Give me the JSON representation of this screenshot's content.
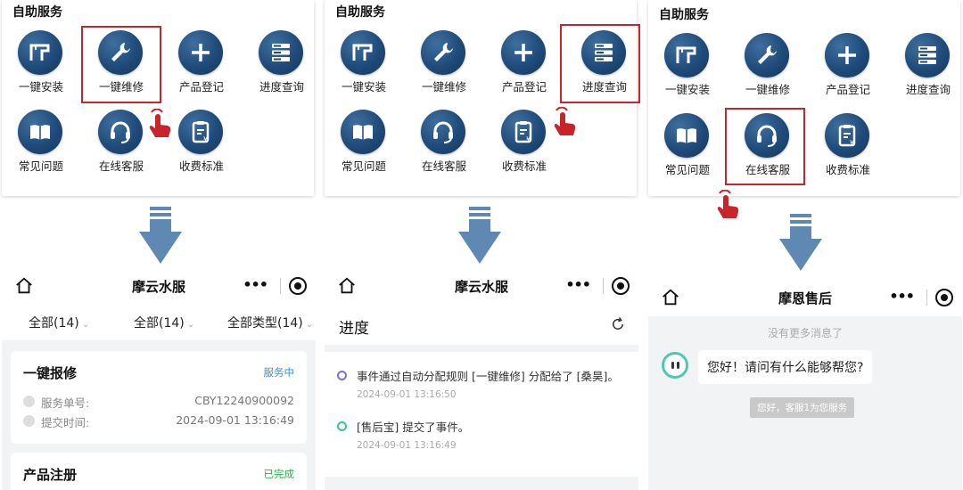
{
  "panels": [
    {
      "section_title": "自助服务",
      "items": [
        {
          "label": "一键安装",
          "icon": "pipe-install-icon"
        },
        {
          "label": "一键维修",
          "icon": "wrench-icon"
        },
        {
          "label": "产品登记",
          "icon": "plus-icon"
        },
        {
          "label": "进度查询",
          "icon": "list-stack-icon"
        },
        {
          "label": "常见问题",
          "icon": "book-icon"
        },
        {
          "label": "在线客服",
          "icon": "headset-icon"
        },
        {
          "label": "收费标准",
          "icon": "price-list-icon"
        }
      ],
      "highlighted": "一键维修"
    },
    {
      "section_title": "自助服务",
      "items": [
        {
          "label": "一键安装",
          "icon": "pipe-install-icon"
        },
        {
          "label": "一键维修",
          "icon": "wrench-icon"
        },
        {
          "label": "产品登记",
          "icon": "plus-icon"
        },
        {
          "label": "进度查询",
          "icon": "list-stack-icon"
        },
        {
          "label": "常见问题",
          "icon": "book-icon"
        },
        {
          "label": "在线客服",
          "icon": "headset-icon"
        },
        {
          "label": "收费标准",
          "icon": "price-list-icon"
        }
      ],
      "highlighted": "进度查询"
    },
    {
      "section_title": "自助服务",
      "items": [
        {
          "label": "一键安装",
          "icon": "pipe-install-icon"
        },
        {
          "label": "一键维修",
          "icon": "wrench-icon"
        },
        {
          "label": "产品登记",
          "icon": "plus-icon"
        },
        {
          "label": "进度查询",
          "icon": "list-stack-icon"
        },
        {
          "label": "常见问题",
          "icon": "book-icon"
        },
        {
          "label": "在线客服",
          "icon": "headset-icon"
        },
        {
          "label": "收费标准",
          "icon": "price-list-icon"
        }
      ],
      "highlighted": "在线客服"
    }
  ],
  "screen1": {
    "title": "摩云水服",
    "more": "•••",
    "filters": [
      "全部(14)",
      "全部(14)",
      "全部类型(14)"
    ],
    "orders": [
      {
        "title": "一键报修",
        "status": "服务中",
        "status_color": "#3a8ee6",
        "service_no_label": "服务单号:",
        "service_no": "CBY12240900092",
        "submit_label": "提交时间:",
        "submit_time": "2024-09-01 13:16:49"
      },
      {
        "title": "产品注册",
        "status": "已完成",
        "status_color": "#2bb24c"
      }
    ]
  },
  "screen2": {
    "title": "摩云水服",
    "more": "•••",
    "progress_title": "进度",
    "events": [
      {
        "text": "事件通过自动分配规则 [一键维修] 分配给了 [桑昊]。",
        "time": "2024-09-01 13:16:50",
        "color": "#7b6fd6"
      },
      {
        "text": "[售后宝] 提交了事件。",
        "time": "2024-09-01 13:16:49",
        "color": "#3cc28a"
      }
    ]
  },
  "screen3": {
    "title": "摩恩售后",
    "more": "•••",
    "no_more": "没有更多消息了",
    "greeting": "您好！请问有什么能够帮您?",
    "system_msg": "您好，客服1为您服务"
  },
  "colors": {
    "highlight": "#c8242c",
    "icon_bg": "#1f4b7a",
    "arrow": "#5f89b3",
    "hand": "#c8242c"
  }
}
